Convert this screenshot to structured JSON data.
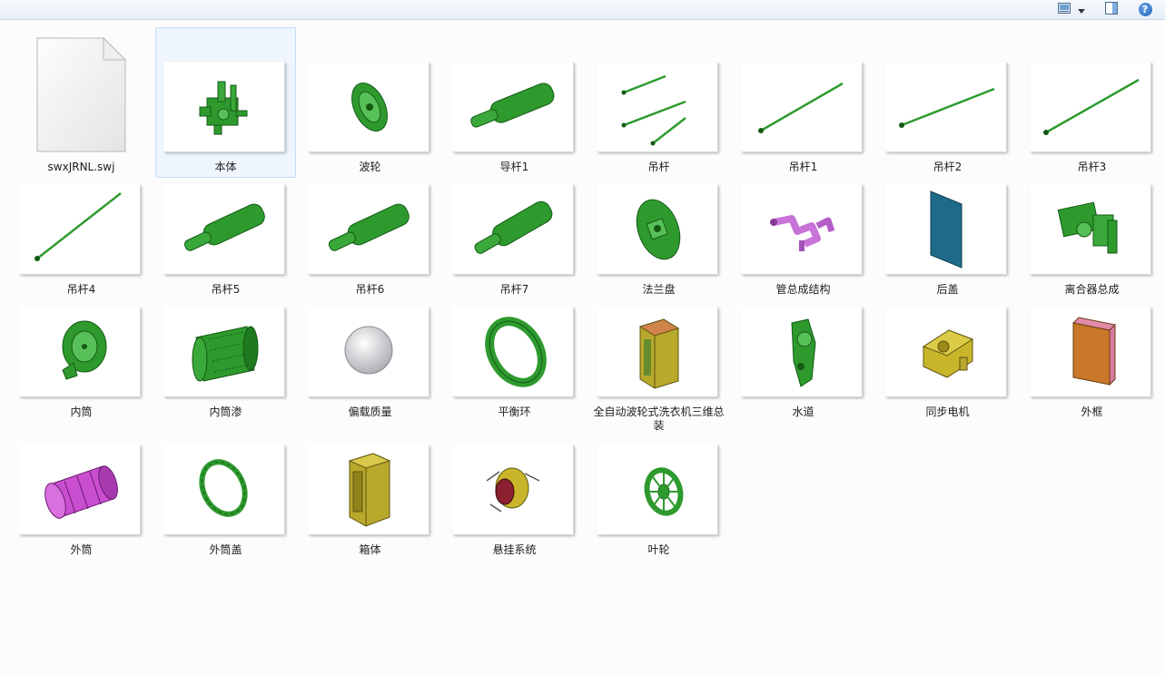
{
  "toolbar": {
    "view_icon": "view-options-icon",
    "dropdown_icon": "chevron-down-icon",
    "preview_icon": "preview-pane-icon",
    "help_icon": "help-icon",
    "help_glyph": "?"
  },
  "files": [
    {
      "label": "swxJRNL.swj",
      "icon": "document-icon"
    },
    {
      "label": "本体",
      "icon": "part-thumbnail"
    },
    {
      "label": "波轮",
      "icon": "part-thumbnail"
    },
    {
      "label": "导杆1",
      "icon": "part-thumbnail"
    },
    {
      "label": "吊杆",
      "icon": "part-thumbnail"
    },
    {
      "label": "吊杆1",
      "icon": "part-thumbnail"
    },
    {
      "label": "吊杆2",
      "icon": "part-thumbnail"
    },
    {
      "label": "吊杆3",
      "icon": "part-thumbnail"
    },
    {
      "label": "吊杆4",
      "icon": "part-thumbnail"
    },
    {
      "label": "吊杆5",
      "icon": "part-thumbnail"
    },
    {
      "label": "吊杆6",
      "icon": "part-thumbnail"
    },
    {
      "label": "吊杆7",
      "icon": "part-thumbnail"
    },
    {
      "label": "法兰盘",
      "icon": "part-thumbnail"
    },
    {
      "label": "管总成结构",
      "icon": "part-thumbnail"
    },
    {
      "label": "后盖",
      "icon": "part-thumbnail"
    },
    {
      "label": "离合器总成",
      "icon": "part-thumbnail"
    },
    {
      "label": "内筒",
      "icon": "part-thumbnail"
    },
    {
      "label": "内筒渗",
      "icon": "part-thumbnail"
    },
    {
      "label": "偏载质量",
      "icon": "part-thumbnail"
    },
    {
      "label": "平衡环",
      "icon": "part-thumbnail"
    },
    {
      "label": "全自动波轮式洗衣机三维总装",
      "icon": "assembly-thumbnail"
    },
    {
      "label": "水道",
      "icon": "part-thumbnail"
    },
    {
      "label": "同步电机",
      "icon": "part-thumbnail"
    },
    {
      "label": "外框",
      "icon": "part-thumbnail"
    },
    {
      "label": "外筒",
      "icon": "part-thumbnail"
    },
    {
      "label": "外筒盖",
      "icon": "part-thumbnail"
    },
    {
      "label": "箱体",
      "icon": "part-thumbnail"
    },
    {
      "label": "悬挂系统",
      "icon": "assembly-thumbnail"
    },
    {
      "label": "叶轮",
      "icon": "part-thumbnail"
    }
  ],
  "colors": {
    "part_green": "#2e9a2e",
    "selection_bg": "#eef5fd",
    "selection_border": "#c6dcf5"
  }
}
